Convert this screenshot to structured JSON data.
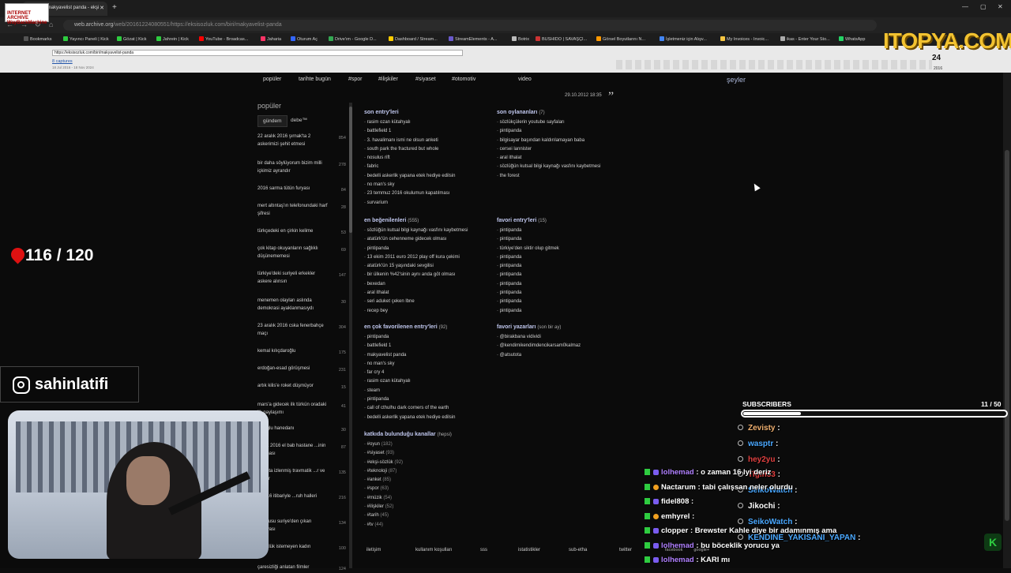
{
  "browser": {
    "tab_title": "kullanıcı makyavelist panda - ekşi",
    "url_host": "web.archive.org",
    "url_path": "/web/20161224080551/https://eksisozluk.com/biri/makyavelist-panda",
    "bookmarks": [
      {
        "label": "Bookmarks",
        "color": "#555555"
      },
      {
        "label": "Yayıncı Paneli | Kick",
        "color": "#2ecc40"
      },
      {
        "label": "Gözat | Kick",
        "color": "#2ecc40"
      },
      {
        "label": "Jahrein | Kick",
        "color": "#2ecc40"
      },
      {
        "label": "YouTube - Broadcas...",
        "color": "#ff0000"
      },
      {
        "label": "Jaharia",
        "color": "#ff3366"
      },
      {
        "label": "Oturum Aç",
        "color": "#3366ff"
      },
      {
        "label": "Drive'ım - Google D...",
        "color": "#34a853"
      },
      {
        "label": "Dashboard / Stream...",
        "color": "#ffcc00"
      },
      {
        "label": "StreamElements - A...",
        "color": "#6a5acd"
      },
      {
        "label": "Botrix",
        "color": "#bbbbbb"
      },
      {
        "label": "BUSHIDO | SAVAŞÇI...",
        "color": "#cc3333"
      },
      {
        "label": "Görsel Boyutlarını N...",
        "color": "#ff9900"
      },
      {
        "label": "İşletmeniz için Alışv...",
        "color": "#4285f4"
      },
      {
        "label": "My Invoices - Invoic...",
        "color": "#f5c542"
      },
      {
        "label": "ikas - Enter Your Sto...",
        "color": "#aaaaaa"
      },
      {
        "label": "WhatsApp",
        "color": "#25d366"
      }
    ]
  },
  "wayback": {
    "logo": "INTERNET ARCHIVE WayBackMachine",
    "input_url": "https://eksisozluk.com/biri/makyavelist-panda",
    "captures": "8 captures",
    "date_range": "18 Jul 2016 - 18 Nov 2024",
    "day": "24",
    "year": "2016"
  },
  "site": {
    "nav": [
      "popüler",
      "tarihte bugün",
      "#spor",
      "#ilişkiler",
      "#siyaset",
      "#otomotiv",
      "video"
    ],
    "seyler": "şeyler",
    "date": "29.10.2012 18:35",
    "quote": "”",
    "sidebar_title": "popüler",
    "sidebar_tabs": [
      "gündem",
      "debe™"
    ],
    "sidebar_items": [
      {
        "title": "22 aralık 2016 şırnak'ta 2 askerimizi şehit etmesi",
        "count": "854"
      },
      {
        "title": "bir daha söylüyorum bizim milli içkimiz ayrandır",
        "count": "278"
      },
      {
        "title": "2016 sarma tütün furyası",
        "count": "84"
      },
      {
        "title": "mert altıntaş'ın telefonundaki harf şifresi",
        "count": "28"
      },
      {
        "title": "türkçedeki en çirkin kelime",
        "count": "53"
      },
      {
        "title": "çok kitap okuyanların sağlıklı düşünememesi",
        "count": "69"
      },
      {
        "title": "türkiye'deki suriyeli erkekler askere alınsın",
        "count": "147"
      },
      {
        "title": "menemen olayları aslında demokrasi ayaklanmasıydı",
        "count": "30"
      },
      {
        "title": "23 aralık 2016 cska fenerbahçe maçı",
        "count": "304"
      },
      {
        "title": "kemal kılıçdaroğlu",
        "count": "175"
      },
      {
        "title": "erdoğan-esad görüşmesi",
        "count": "231"
      },
      {
        "title": "artık kilis'e roket düşmüyor",
        "count": "15"
      },
      {
        "title": "mars'a gidecek ilk türkün oradaki ilk paylaşımı",
        "count": "41"
      },
      {
        "title": "...noğlu hanedanı",
        "count": "30"
      },
      {
        "title": "...alık 2016 el bab hastane ...inin alınması",
        "count": "87"
      },
      {
        "title": "...yaşta izlenmiş travmatik ...r ve filmler",
        "count": "135"
      },
      {
        "title": "...2016 itibariyle ...ruh halleri",
        "count": "216"
      },
      {
        "title": "...ordusu suriye'den çıkan ...anyası",
        "count": "134"
      },
      {
        "title": "...yüzlük istemeyen kadın",
        "count": "100"
      },
      {
        "title": "çaresizliği anlatan filmler",
        "count": "124"
      }
    ],
    "sections": {
      "son_entryleri": {
        "title": "son entry'leri",
        "count": "",
        "items": [
          "rasim ozan kütahyalı",
          "battlefield 1",
          "3. havalimanı ismi ne olsun anketi",
          "south park the fractured but whole",
          "nosulus rift",
          "fabric",
          "bedelli askerlik yapana etek hediye edilsin",
          "no man's sky",
          "23 temmuz 2016 okulumun kapatılması",
          "survarium"
        ]
      },
      "son_oylananlari": {
        "title": "son oylananları",
        "count": "(7)",
        "items": [
          "sözlükçülerin youtube sayfaları",
          "pintipanda",
          "bilgisayar başından kaldırılamayan baba",
          "cersei lannister",
          "aral ithalat",
          "sözlüğün kutsal bilgi kaynağı vasfını kaybetmesi",
          "the forest"
        ]
      },
      "en_begenilenleri": {
        "title": "en beğenilenleri",
        "count": "(555)",
        "items": [
          "sözlüğün kutsal bilgi kaynağı vasfını kaybetmesi",
          "atatürk'ün cehenneme gidecek olması",
          "pintipanda",
          "13 ekim 2011 euro 2012 play off kura çekimi",
          "atatürk'ün 15 yaşındaki sevgilisi",
          "bir ülkenin %42'sinin aynı anda göt olması",
          "bexedan",
          "aral ithalat",
          "seri aduket çeken lbne",
          "recep bey"
        ]
      },
      "favori_entryleri": {
        "title": "favori entry'leri",
        "count": "(15)",
        "items": [
          "pintipanda",
          "pintipanda",
          "türkiye'den siktir olup gitmek",
          "pintipanda",
          "pintipanda",
          "pintipanda",
          "pintipanda",
          "pintipanda",
          "pintipanda",
          "pintipanda"
        ]
      },
      "en_cok_favorilenen": {
        "title": "en çok favorilenen entry'leri",
        "count": "(92)",
        "items": [
          "pintipanda",
          "battlefield 1",
          "makyavelist panda",
          "no man's sky",
          "far cry 4",
          "rasim ozan kütahyalı",
          "steam",
          "pintipanda",
          "call of cthulhu dark corners of the earth",
          "bedelli askerlik yapana etek hediye edilsin"
        ]
      },
      "favori_yazarlari": {
        "title": "favori yazarları",
        "count": "(son bir ay)",
        "items": [
          "@birakbana vidividi",
          "@kendimikendimdencikarsam0kalmaz",
          "@atsutota"
        ]
      },
      "katkida": {
        "title": "katkıda bulunduğu kanallar",
        "count": "(hepsi)",
        "items": [
          {
            "name": "#oyun",
            "count": "(182)"
          },
          {
            "name": "#siyaset",
            "count": "(93)"
          },
          {
            "name": "#ekşi-sözlük",
            "count": "(92)"
          },
          {
            "name": "#teknoloji",
            "count": "(87)"
          },
          {
            "name": "#anket",
            "count": "(85)"
          },
          {
            "name": "#spor",
            "count": "(63)"
          },
          {
            "name": "#müzik",
            "count": "(54)"
          },
          {
            "name": "#ilişkiler",
            "count": "(52)"
          },
          {
            "name": "#tarih",
            "count": "(45)"
          },
          {
            "name": "#tv",
            "count": "(44)"
          }
        ]
      }
    },
    "footer": [
      "iletişim",
      "kullanım koşulları",
      "sss",
      "istatistikler",
      "sub-etha",
      "twitter"
    ],
    "footer_small": [
      "facebook",
      "google+"
    ]
  },
  "overlay": {
    "counter": "116 / 120",
    "instagram": "sahinlatifi",
    "brand": "ITOPYA.COM",
    "subscribers_title": "SUBSCRIBERS",
    "subscribers_count": "11 / 50",
    "subscribers_progress": 0.22,
    "subscriber_list": [
      {
        "name": "Zevisty",
        "color": "#f0b070"
      },
      {
        "name": "wasptr",
        "color": "#4aa8ff"
      },
      {
        "name": "hey2yu",
        "color": "#e04040"
      },
      {
        "name": "Tigin53",
        "color": "#e04040"
      },
      {
        "name": "SeikoWatch",
        "color": "#4aa8ff"
      },
      {
        "name": "Jikochi",
        "color": "#ffffff"
      },
      {
        "name": "SeikoWatch",
        "color": "#4aa8ff"
      },
      {
        "name": "KENDINE_YAKISANI_YAPAN",
        "color": "#4aa8ff"
      }
    ],
    "chat": [
      {
        "user": "lolhemad",
        "msg": "o zaman 16 lyi deriz",
        "color": "#b080ff"
      },
      {
        "user": "Nactarum",
        "msg": "tabi çalışsan neler olurdu",
        "color": "#ffffff"
      },
      {
        "user": "fidel808",
        "msg": "",
        "color": "#ffffff"
      },
      {
        "user": "emhyrel",
        "msg": "",
        "color": "#ffffff"
      },
      {
        "user": "clopper",
        "msg": "Brewster Kahle diye bir adamınmış ama",
        "color": "#ffffff"
      },
      {
        "user": "lolhemad",
        "msg": "bu böceklik yorucu ya",
        "color": "#b080ff"
      },
      {
        "user": "lolhemad",
        "msg": "KARI mı",
        "color": "#b080ff"
      }
    ],
    "kick_icon": "K"
  }
}
